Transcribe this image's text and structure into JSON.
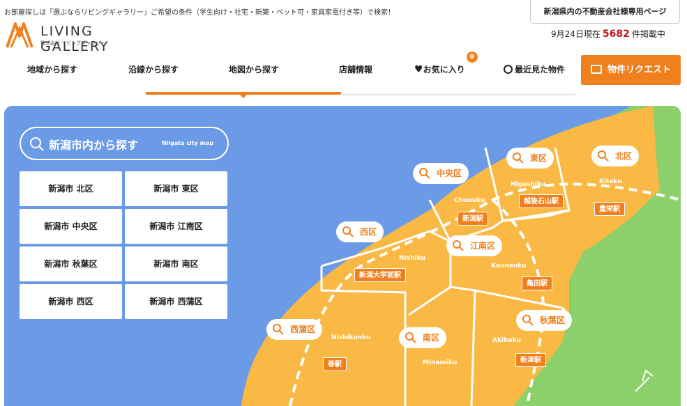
{
  "header": {
    "tagline": "お部屋探しは「選ぶならリビングギャラリー」ご希望の条件（学生向け・社宅・新築・ペット可・家具家電付き等）で検索！",
    "logo_name": "LIVING GALLERY",
    "logo_sub": "株式会社 リビングギャラリー",
    "biz_link": "新潟県内の不動産会社様専用ページ",
    "count_date": "9月24日現在",
    "count_num": "5682",
    "count_suffix": "件掲載中"
  },
  "nav": {
    "area": "地域から探す",
    "line": "沿線から探す",
    "map": "地図から探す",
    "store": "店舗情報",
    "favorites": "お気に入り",
    "favorites_count": "0",
    "recent": "最近見た物件",
    "request": "物件リクエスト"
  },
  "map": {
    "search_title": "新潟市内から探す",
    "search_sub": "Niigata city map",
    "wards": [
      "新潟市 北区",
      "新潟市 東区",
      "新潟市 中央区",
      "新潟市 江南区",
      "新潟市 秋葉区",
      "新潟市 南区",
      "新潟市 西区",
      "新潟市 西蒲区"
    ],
    "pills": {
      "chuo": "中央区",
      "higashi": "東区",
      "kita": "北区",
      "nishi": "西区",
      "konan": "江南区",
      "akiha": "秋葉区",
      "nishikan": "西蒲区",
      "minami": "南区"
    },
    "roman": {
      "chuo": "Chuouku",
      "higashi": "Higashiku",
      "kita": "Kitaku",
      "nishi": "Nishiku",
      "konan": "Kounanku",
      "nishikan": "Nishikanku",
      "akiha": "Akihaku",
      "minami": "Minamiku"
    },
    "stations": {
      "kosenyama": "越後石山駅",
      "niigata": "新潟駅",
      "toyosaka": "豊栄駅",
      "daigakumae": "新潟大学前駅",
      "kameda": "亀田駅",
      "maki": "巻駅",
      "niitsu": "新津駅"
    },
    "colors": {
      "sea": "#6b9ae6",
      "land": "#f9b944",
      "green": "#8bd06b",
      "accent": "#f0801d"
    }
  }
}
